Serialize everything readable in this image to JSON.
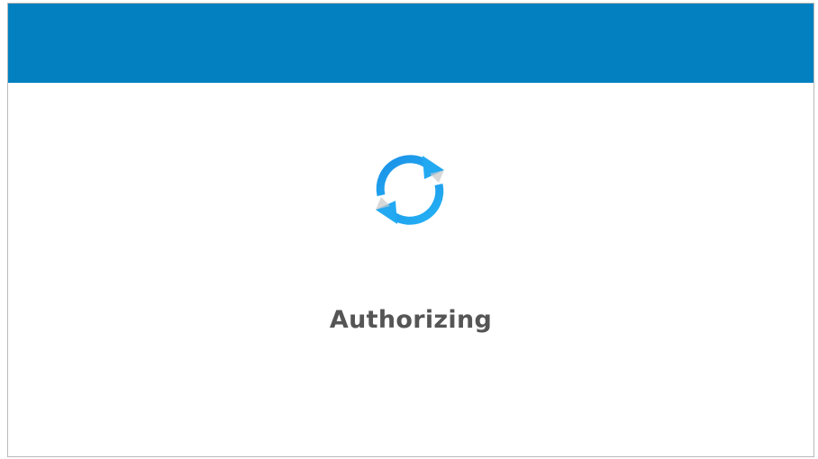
{
  "dialog": {
    "header_color": "#0280c0",
    "spinner_icon": "refresh-icon",
    "spinner_color": "#1a9cf0",
    "status_text": "Authorizing"
  }
}
